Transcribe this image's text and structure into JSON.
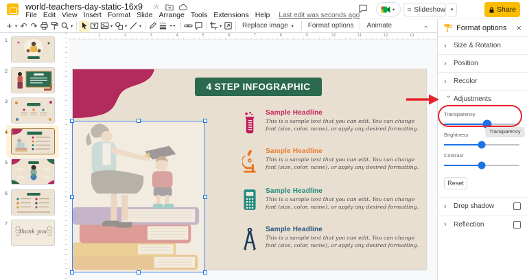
{
  "titlebar": {
    "title": "world-teachers-day-static-16x9",
    "menu_items": [
      "File",
      "Edit",
      "View",
      "Insert",
      "Format",
      "Slide",
      "Arrange",
      "Tools",
      "Extensions",
      "Help"
    ],
    "last_edit": "Last edit was seconds ago",
    "slideshow_label": "Slideshow",
    "share_label": "Share"
  },
  "toolbar": {
    "replace_image_label": "Replace image",
    "format_options_label": "Format options",
    "animate_label": "Animate"
  },
  "filmstrip": {
    "selected_slide": 4,
    "slides": [
      {
        "number": "1"
      },
      {
        "number": "2"
      },
      {
        "number": "3"
      },
      {
        "number": "4"
      },
      {
        "number": "5"
      },
      {
        "number": "6"
      },
      {
        "number": "7",
        "caption": "thank you"
      }
    ]
  },
  "canvas": {
    "ruler_numbers": [
      "1",
      "2",
      "3",
      "4",
      "5",
      "6",
      "7",
      "8",
      "9",
      "10",
      "11",
      "12",
      "13"
    ]
  },
  "slide": {
    "title": "4 STEP INFOGRAPHIC",
    "body_text": "This is a sample text that you can edit. You can change font (size, color, name), or apply any desired formatting.",
    "items": [
      {
        "icon": "beaker-icon",
        "headline": "Sample Headline",
        "color": "#c2255c"
      },
      {
        "icon": "microscope-icon",
        "headline": "Sample Headline",
        "color": "#e87b2e"
      },
      {
        "icon": "calculator-icon",
        "headline": "Sample Headline",
        "color": "#1f8a7f"
      },
      {
        "icon": "compass-icon",
        "headline": "Sample Headline",
        "color": "#27517e"
      }
    ]
  },
  "panel": {
    "title": "Format options",
    "sections": [
      {
        "label": "Size & Rotation",
        "expanded": false
      },
      {
        "label": "Position",
        "expanded": false
      },
      {
        "label": "Recolor",
        "expanded": false
      },
      {
        "label": "Adjustments",
        "expanded": true
      }
    ],
    "adjustments": {
      "sliders": [
        {
          "label": "Transparency",
          "value_pct": 57
        },
        {
          "label": "Brightness",
          "value_pct": 50
        },
        {
          "label": "Contrast",
          "value_pct": 50
        }
      ],
      "reset_label": "Reset",
      "tooltip": "Transparency"
    },
    "toggles": [
      {
        "label": "Drop shadow",
        "checked": false
      },
      {
        "label": "Reflection",
        "checked": false
      }
    ]
  },
  "colors": {
    "accent_blue": "#1a73e8",
    "share_yellow": "#fbbc04",
    "annotation_red": "#e8232b",
    "slide_bg": "#e9dfd0",
    "slide_green": "#2b6a4f",
    "slide_pink": "#b32a5c",
    "selected_thumb_highlight": "#fdf3dd"
  }
}
